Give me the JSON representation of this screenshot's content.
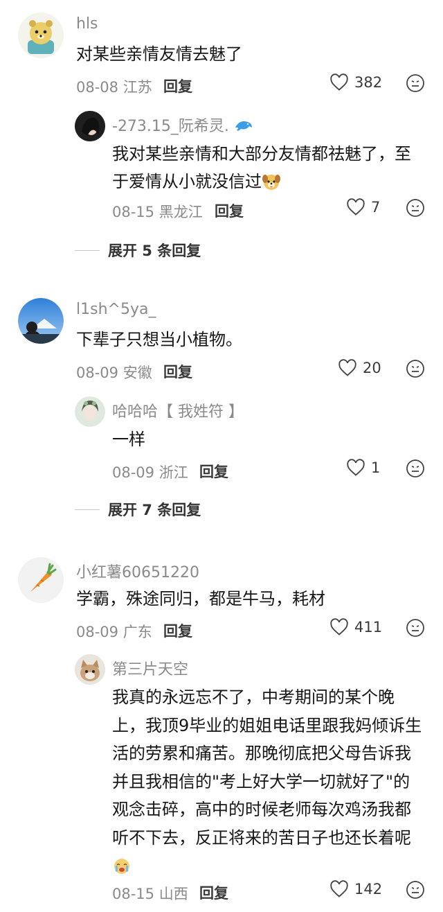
{
  "comments": [
    {
      "username": "hls",
      "text": "对某些亲情友情去魅了",
      "date_loc": "08-08 江苏",
      "reply_label": "回复",
      "likes": "382",
      "replies": [
        {
          "username": "-273.15_阮希灵.",
          "text": "我对某些亲情和大部分友情都祛魅了，至于爱情从小就没信过",
          "date_loc": "08-15 黑龙江",
          "reply_label": "回复",
          "likes": "7"
        }
      ],
      "expand_label": "展开 5 条回复"
    },
    {
      "username": "l1sh^5ya_",
      "text": "下辈子只想当小植物。",
      "date_loc": "08-09 安徽",
      "reply_label": "回复",
      "likes": "20",
      "replies": [
        {
          "username": "哈哈哈【 我姓符 】",
          "text": "一样",
          "date_loc": "08-09 浙江",
          "reply_label": "回复",
          "likes": "1"
        }
      ],
      "expand_label": "展开 7 条回复"
    },
    {
      "username": "小红薯60651220",
      "text": "学霸，殊途同归，都是牛马，耗材",
      "date_loc": "08-09 广东",
      "reply_label": "回复",
      "likes": "411",
      "replies": [
        {
          "username": "第三片天空",
          "text": "我真的永远忘不了，中考期间的某个晚上，我顶9毕业的姐姐电话里跟我妈倾诉生活的劳累和痛苦。那晚彻底把父母告诉我并且我相信的\"考上好大学一切就好了\"的观念击碎，高中的时候老师每次鸡汤我都听不下去，反正将来的苦日子也还长着呢",
          "date_loc": "08-15 山西",
          "reply_label": "回复",
          "likes": "142"
        }
      ]
    }
  ],
  "icons": {
    "like": "heart-outline-icon",
    "dislike": "dislike-face-icon",
    "username_badge": "dolphin-icon",
    "reply_emoji": "puppy-face-emoji",
    "cry_emoji": "crying-face-emoji"
  },
  "colors": {
    "text": "#161616",
    "muted": "#8a8a8a",
    "background": "#ffffff"
  }
}
